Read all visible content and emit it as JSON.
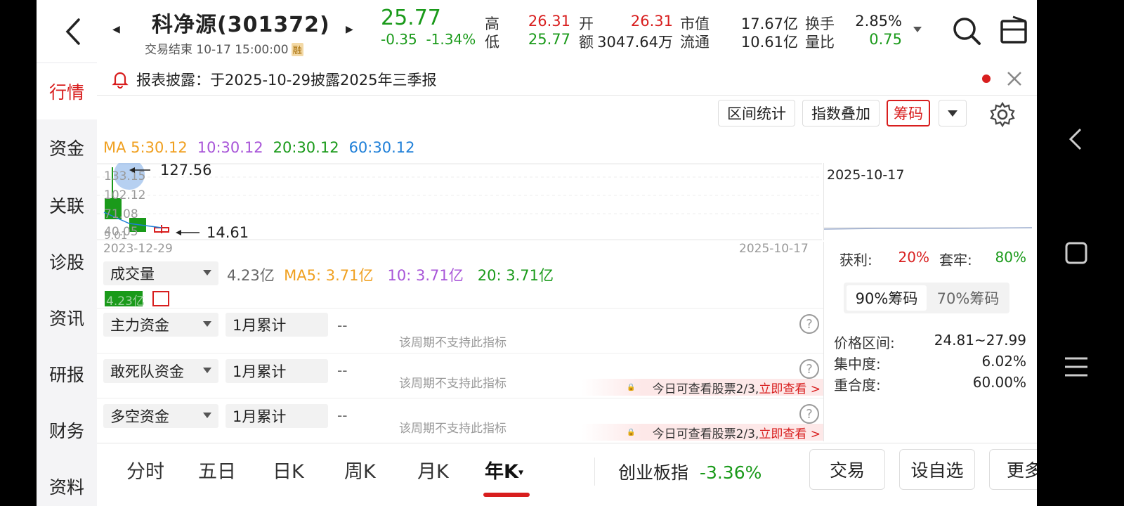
{
  "header": {
    "stock_name": "科净源(301372)",
    "status": "交易结束 10-17 15:00:00",
    "rong_badge": "融",
    "price": "25.77",
    "change": "-0.35",
    "change_pct": "-1.34%",
    "high_label": "高",
    "high": "26.31",
    "low_label": "低",
    "low": "25.77",
    "open_label": "开",
    "open": "26.31",
    "amount_label": "额",
    "amount": "3047.64万",
    "mktcap_label": "市值",
    "mktcap": "17.67亿",
    "float_label": "流通",
    "float": "10.61亿",
    "turnover_label": "换手",
    "turnover": "2.85%",
    "vol_ratio_label": "量比",
    "vol_ratio": "0.75"
  },
  "nav": [
    "行情",
    "资金",
    "关联",
    "诊股",
    "资讯",
    "研报",
    "财务",
    "资料"
  ],
  "notice": "报表披露：于2025-10-29披露2025年三季报",
  "toolbar": {
    "range_stats": "区间统计",
    "index_overlay": "指数叠加",
    "chips": "筹码"
  },
  "ma": {
    "ma5": "MA 5:30.12",
    "ma10": "10:30.12",
    "ma20": "20:30.12",
    "ma60": "60:30.12"
  },
  "chart": {
    "y_labels": [
      "133.15",
      "102.12",
      "71.08",
      "40.05",
      "9.01"
    ],
    "high_marker": "127.56",
    "low_marker": "14.61",
    "date_start": "2023-12-29",
    "date_end": "2025-10-17",
    "side_date": "2025-10-17"
  },
  "volume": {
    "selector": "成交量",
    "value": "4.23亿",
    "ma5": "MA5: 3.71亿",
    "ma10": "10: 3.71亿",
    "ma20": "20: 3.71亿",
    "bar_label": "4.23亿"
  },
  "indicators": [
    {
      "name": "主力资金",
      "period": "1月累计",
      "value": "--",
      "note": "该周期不支持此指标"
    },
    {
      "name": "敢死队资金",
      "period": "1月累计",
      "value": "--",
      "note": "该周期不支持此指标",
      "lock_text": "今日可查看股票2/3,",
      "lock_link": "立即查看 >"
    },
    {
      "name": "多空资金",
      "period": "1月累计",
      "value": "--",
      "note": "该周期不支持此指标",
      "lock_text": "今日可查看股票2/3,",
      "lock_link": "立即查看 >"
    }
  ],
  "chips_panel": {
    "profit_label": "获利:",
    "profit": "20%",
    "trapped_label": "套牢:",
    "trapped": "80%",
    "tab90": "90%筹码",
    "tab70": "70%筹码",
    "range_label": "价格区间:",
    "range": "24.81~27.99",
    "conc_label": "集中度:",
    "conc": "6.02%",
    "overlap_label": "重合度:",
    "overlap": "60.00%"
  },
  "bottom": {
    "periods": [
      "分时",
      "五日",
      "日K",
      "周K",
      "月K",
      "年K"
    ],
    "index_name": "创业板指",
    "index_change": "-3.36%",
    "trade": "交易",
    "add_fav": "设自选",
    "more": "更多"
  },
  "colors": {
    "up": "#d81e1e",
    "down": "#1a9a1a",
    "ma5": "#f0a020",
    "ma10": "#a855d8",
    "ma20": "#1a9a1a",
    "ma60": "#1e7fd8"
  }
}
